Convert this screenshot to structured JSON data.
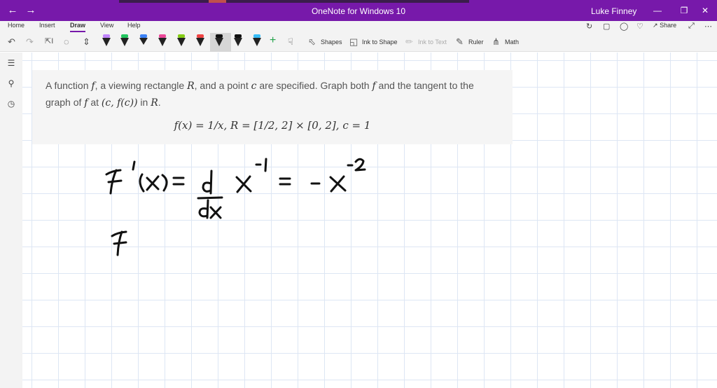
{
  "window": {
    "title": "OneNote for Windows 10",
    "user": "Luke Finney",
    "back_icon": "arrow-left-icon",
    "forward_icon": "arrow-right-icon"
  },
  "menu": {
    "tabs": [
      "Home",
      "Insert",
      "Draw",
      "View",
      "Help"
    ],
    "active_tab": "Draw",
    "share_label": "Share"
  },
  "ribbon": {
    "shapes_label": "Shapes",
    "ink_to_shape_label": "Ink to Shape",
    "ink_to_text_label": "Ink to Text",
    "ruler_label": "Ruler",
    "math_label": "Math",
    "pens": [
      {
        "color": "#c084fc",
        "type": "pen"
      },
      {
        "color": "#22c55e",
        "type": "pen"
      },
      {
        "color": "#3b82f6",
        "type": "highlighter"
      },
      {
        "color": "#ec4899",
        "type": "pen"
      },
      {
        "color": "#84cc16",
        "type": "pen"
      },
      {
        "color": "#ef4444",
        "type": "pen"
      },
      {
        "color": "#111111",
        "type": "pen"
      },
      {
        "color": "#111111",
        "type": "pen"
      },
      {
        "color": "#38bdf8",
        "type": "pen"
      }
    ]
  },
  "problem": {
    "line1_pre": "A function ",
    "f1": "f",
    "line1_mid1": ", a viewing rectangle ",
    "R1": "R",
    "line1_mid2": ", and a point ",
    "c1": "c",
    "line1_mid3": " are specified. Graph both ",
    "f2": "f",
    "line1_end": " and the tangent to the",
    "line2_pre": "graph of ",
    "f3": "f",
    "line2_mid": " at ",
    "point": "(c, f(c))",
    "line2_mid2": " in ",
    "R2": "R",
    "line2_end": ".",
    "formula": "f(x) = 1/x, R = [1/2, 2] × [0, 2], c = 1"
  },
  "accent_color": "#7719aa"
}
